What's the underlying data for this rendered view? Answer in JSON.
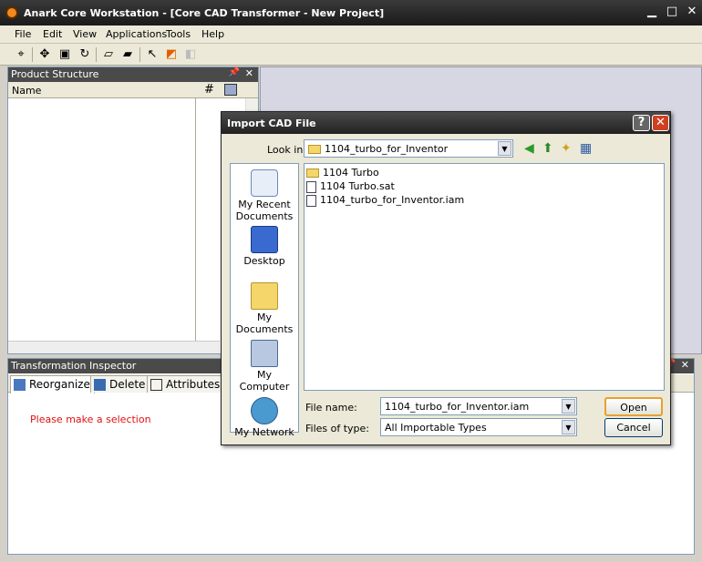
{
  "window": {
    "title": "Anark Core Workstation - [Core CAD Transformer - New Project]"
  },
  "menu": [
    "File",
    "Edit",
    "View",
    "Applications",
    "Tools",
    "Help"
  ],
  "product_structure": {
    "title": "Product Structure",
    "col_name": "Name",
    "col_hash": "#"
  },
  "inspector": {
    "title": "Transformation Inspector",
    "tabs": [
      "Reorganize",
      "Delete",
      "Attributes"
    ],
    "message": "Please make a selection"
  },
  "dialog": {
    "title": "Import CAD File",
    "look_in_label": "Look in:",
    "look_in_value": "1104_turbo_for_Inventor",
    "places": [
      "My Recent Documents",
      "Desktop",
      "My Documents",
      "My Computer",
      "My Network"
    ],
    "files": [
      {
        "name": "1104 Turbo",
        "type": "folder"
      },
      {
        "name": "1104 Turbo.sat",
        "type": "file"
      },
      {
        "name": "1104_turbo_for_Inventor.iam",
        "type": "file"
      }
    ],
    "file_name_label": "File name:",
    "file_name_value": "1104_turbo_for_Inventor.iam",
    "file_type_label": "Files of type:",
    "file_type_value": "All Importable Types",
    "open_label": "Open",
    "cancel_label": "Cancel"
  }
}
